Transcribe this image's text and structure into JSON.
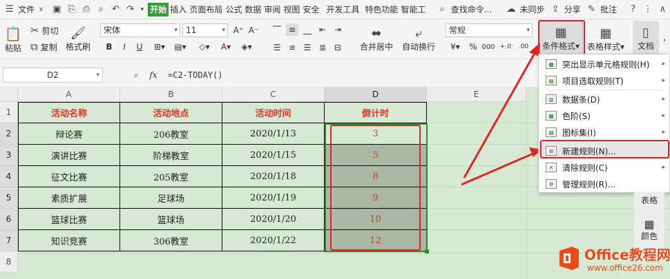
{
  "menu": {
    "file_label": "文件",
    "tabs": [
      "开始",
      "插入",
      "页面布局",
      "公式",
      "数据",
      "审阅",
      "视图",
      "安全",
      "开发工具",
      "特色功能",
      "智能工"
    ],
    "search_label": "查找命令...",
    "sync_label": "未同步",
    "share_label": "分享",
    "comment_label": "批注"
  },
  "ribbon": {
    "paste_label": "粘贴",
    "cut_label": "剪切",
    "copy_label": "复制",
    "format_painter_label": "格式刷",
    "font_name": "宋体",
    "font_size": "11",
    "merge_label": "合并居中",
    "wrap_label": "自动换行",
    "number_format": "常规",
    "cond_format_label": "条件格式",
    "table_style_label": "表格样式",
    "doc_label": "文档"
  },
  "formula": {
    "cell_ref": "D2",
    "fx": "fx",
    "content": "=C2-TODAY()"
  },
  "columns": [
    "A",
    "B",
    "C",
    "D",
    "E"
  ],
  "rows": [
    "1",
    "2",
    "3",
    "4",
    "5",
    "6",
    "7",
    "8"
  ],
  "headers": [
    "活动名称",
    "活动地点",
    "活动时间",
    "倒计时"
  ],
  "table": [
    [
      "辩论赛",
      "206教室",
      "2020/1/13",
      "3"
    ],
    [
      "演讲比赛",
      "阶梯教室",
      "2020/1/15",
      "5"
    ],
    [
      "征文比赛",
      "205教室",
      "2020/1/18",
      "8"
    ],
    [
      "素质扩展",
      "足球场",
      "2020/1/19",
      "9"
    ],
    [
      "篮球比赛",
      "篮球场",
      "2020/1/20",
      "10"
    ],
    [
      "知识竞赛",
      "306教室",
      "2020/1/22",
      "12"
    ]
  ],
  "dropdown": {
    "items": [
      {
        "label": "突出显示单元格规则(H)",
        "has_sub": true
      },
      {
        "label": "项目选取规则(T)",
        "has_sub": true
      },
      {
        "label": "数据条(D)",
        "has_sub": true
      },
      {
        "label": "色阶(S)",
        "has_sub": true
      },
      {
        "label": "图标集(I)",
        "has_sub": true
      },
      {
        "label": "新建规则(N)...",
        "has_sub": false
      },
      {
        "label": "清除规则(C)",
        "has_sub": true
      },
      {
        "label": "管理规则(R)...",
        "has_sub": false
      }
    ]
  },
  "side_panel": {
    "table_label": "表格",
    "color_label": "颜色"
  },
  "watermark": {
    "brand": "Office教程网",
    "url": "www.office26.com"
  },
  "colors": {
    "accent": "#3a9a3a",
    "highlight_red": "#e32222",
    "sheet_bg": "#d6e9d3"
  }
}
